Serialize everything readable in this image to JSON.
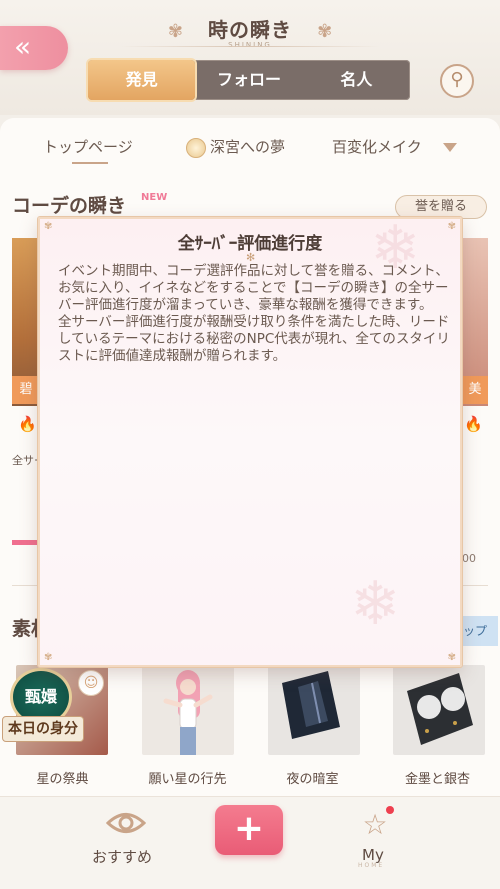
{
  "header": {
    "back_icon": "«",
    "title": "時の瞬き",
    "subtitle": "SHINING",
    "title_deco": "✾",
    "main_tabs": [
      "発見",
      "フォロー",
      "名人"
    ],
    "search_icon": "⚲"
  },
  "sub_tabs": {
    "items": [
      "トップページ",
      "深宮への夢",
      "百変化メイク"
    ],
    "active": "トップページ"
  },
  "section1": {
    "title": "コーデの瞬き",
    "new_badge": "NEW",
    "honor_button": "誉を贈る",
    "peek_left_label": "碧",
    "peek_right_label": "美",
    "peek_left_caption": "全サー",
    "peek_right_num": "00",
    "fire_icon": "🔥"
  },
  "section2": {
    "title": "素材",
    "right_peek": "ップ"
  },
  "materials": [
    {
      "label": "星の祭典"
    },
    {
      "label": "願い星の行先"
    },
    {
      "label": "夜の暗室"
    },
    {
      "label": "金墨と銀杏"
    }
  ],
  "badge": {
    "circle_text": "甄嬛",
    "ribbon_text": "本日の身分"
  },
  "modal": {
    "title": "全ｻｰﾊﾞｰ評価進行度",
    "paragraph1": "イベント期間中、コーデ選評作品に対して誉を贈る、コメント、お気に入り、イイネなどをすることで【コーデの瞬き】の全サーバー評価進行度が溜まっていき、豪華な報酬を獲得できます。",
    "paragraph2": "全サーバー評価進行度が報酬受け取り条件を満たした時、リードしているテーマにおける秘密のNPC代表が現れ、全てのスタイリストに評価値達成報酬が贈られます。"
  },
  "bottom_nav": {
    "recommend_label": "おすすめ",
    "create_icon": "+",
    "my_label": "My",
    "my_sub": "HOME",
    "star_icon": "☆"
  },
  "colors": {
    "accent_pink": "#ee8f9f",
    "accent_gold": "#e3a562",
    "tab_bar": "#7a6d68",
    "create_button": "#e95c76"
  }
}
